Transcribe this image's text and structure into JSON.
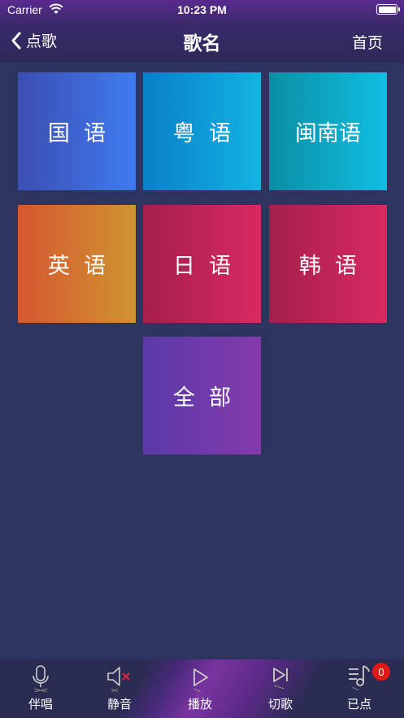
{
  "status_bar": {
    "carrier": "Carrier",
    "time": "10:23 PM"
  },
  "nav": {
    "back_label": "点歌",
    "title": "歌名",
    "home_label": "首页"
  },
  "tiles": [
    {
      "label": "国  语"
    },
    {
      "label": "粤  语"
    },
    {
      "label": "闽南语"
    },
    {
      "label": "英  语"
    },
    {
      "label": "日  语"
    },
    {
      "label": "韩  语"
    },
    {
      "label": "全  部"
    }
  ],
  "bottom_bar": {
    "items": [
      {
        "label": "伴唱",
        "icon": "microphone-icon"
      },
      {
        "label": "静音",
        "icon": "mute-icon"
      },
      {
        "label": "播放",
        "icon": "play-icon"
      },
      {
        "label": "切歌",
        "icon": "next-track-icon"
      },
      {
        "label": "已点",
        "icon": "playlist-icon",
        "badge": "0"
      }
    ]
  },
  "colors": {
    "background": "#2e3460",
    "badge": "#e01818"
  }
}
